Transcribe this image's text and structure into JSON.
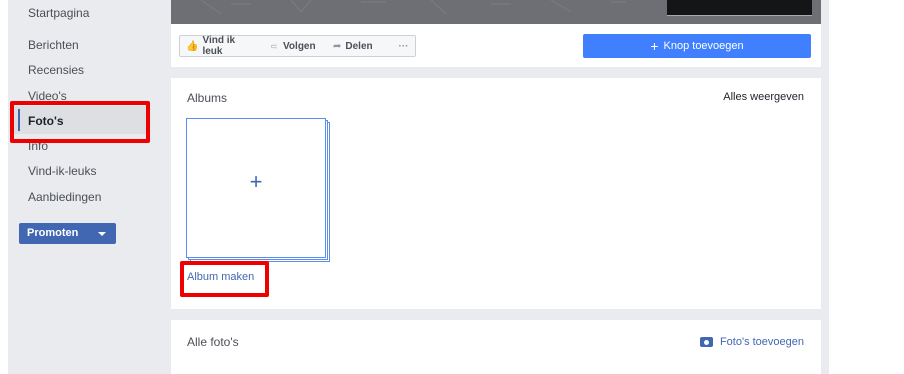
{
  "sidebar": {
    "items": [
      {
        "label": "Startpagina"
      },
      {
        "label": "Berichten"
      },
      {
        "label": "Recensies"
      },
      {
        "label": "Video's"
      },
      {
        "label": "Foto's"
      },
      {
        "label": "Info"
      },
      {
        "label": "Vind-ik-leuks"
      },
      {
        "label": "Aanbiedingen"
      }
    ],
    "active_item": "Foto's",
    "promote_label": "Promoten"
  },
  "action_bar": {
    "like_label": "Vind ik leuk",
    "follow_label": "Volgen",
    "share_label": "Delen",
    "more_label": "···",
    "add_button_label": "Knop toevoegen"
  },
  "albums": {
    "title": "Albums",
    "view_all": "Alles weergeven",
    "create_album": "Album maken"
  },
  "all_photos": {
    "title": "Alle foto's",
    "add_photos": "Foto's toevoegen"
  },
  "icons": {
    "like": "thumbs-up-icon",
    "follow": "rss-icon",
    "share": "share-arrow-icon",
    "add": "plus-icon",
    "dropdown": "caret-down-icon",
    "camera": "camera-icon"
  },
  "colors": {
    "brand_blue": "#4267b2",
    "button_blue": "#4080ff",
    "highlight_red": "#ee0000",
    "page_bg": "#e9ebee"
  }
}
